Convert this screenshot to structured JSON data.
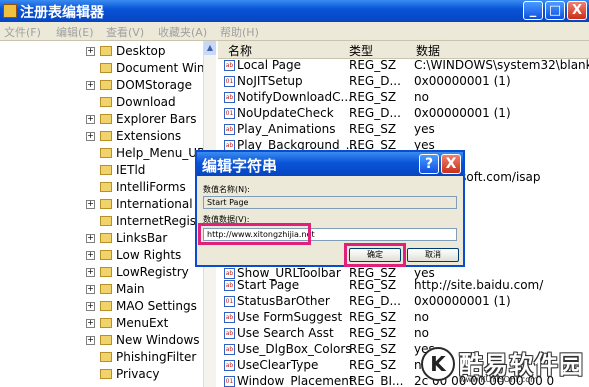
{
  "window": {
    "title": "注册表编辑器",
    "minimize": "_",
    "maximize": "□",
    "close": "X"
  },
  "menu": [
    "文件(F)",
    "编辑(E)",
    "查看(V)",
    "收藏夹(A)",
    "帮助(H)"
  ],
  "tree": {
    "items": [
      {
        "label": "Desktop",
        "expander": "+"
      },
      {
        "label": "Document Windo",
        "expander": ""
      },
      {
        "label": "DOMStorage",
        "expander": "+"
      },
      {
        "label": "Download",
        "expander": ""
      },
      {
        "label": "Explorer Bars",
        "expander": "+"
      },
      {
        "label": "Extensions",
        "expander": "+"
      },
      {
        "label": "Help_Menu_UR",
        "expander": ""
      },
      {
        "label": "IETld",
        "expander": ""
      },
      {
        "label": "IntelliForms",
        "expander": ""
      },
      {
        "label": "International",
        "expander": "+"
      },
      {
        "label": "InternetRegistr",
        "expander": ""
      },
      {
        "label": "LinksBar",
        "expander": "+"
      },
      {
        "label": "Low Rights",
        "expander": "+"
      },
      {
        "label": "LowRegistry",
        "expander": "+"
      },
      {
        "label": "Main",
        "expander": "+"
      },
      {
        "label": "MAO Settings",
        "expander": "+"
      },
      {
        "label": "MenuExt",
        "expander": "+"
      },
      {
        "label": "New Windows",
        "expander": "+"
      },
      {
        "label": "PhishingFilter",
        "expander": ""
      },
      {
        "label": "Privacy",
        "expander": ""
      }
    ]
  },
  "list": {
    "headers": {
      "name": "名称",
      "type": "类型",
      "data": "数据"
    },
    "rows": [
      {
        "name": "Local Page",
        "type": "REG_SZ",
        "data": "C:\\WINDOWS\\system32\\blank.",
        "icon": "ab"
      },
      {
        "name": "NoJITSetup",
        "type": "REG_D...",
        "data": "0x00000001 (1)",
        "icon": "01"
      },
      {
        "name": "NotifyDownloadC...",
        "type": "REG_SZ",
        "data": "no",
        "icon": "ab"
      },
      {
        "name": "NoUpdateCheck",
        "type": "REG_D...",
        "data": "0x00000001 (1)",
        "icon": "01"
      },
      {
        "name": "Play_Animations",
        "type": "REG_SZ",
        "data": "yes",
        "icon": "ab"
      },
      {
        "name": "Play_Background_...",
        "type": "REG_SZ",
        "data": "yes",
        "icon": "ab"
      },
      {
        "name": "",
        "type": "",
        "data": "w.microsoft.com/isap",
        "icon": ""
      },
      {
        "name": "",
        "type": "",
        "data": "",
        "icon": ""
      },
      {
        "name": "",
        "type": "",
        "data": "",
        "icon": ""
      },
      {
        "name": "",
        "type": "",
        "data": "",
        "icon": ""
      },
      {
        "name": "",
        "type": "",
        "data": "",
        "icon": ""
      },
      {
        "name": "",
        "type": "",
        "data": "",
        "icon": ""
      },
      {
        "name": "Show_URLToolbar",
        "type": "REG_SZ",
        "data": "yes",
        "icon": "ab"
      },
      {
        "name": "Start Page",
        "type": "REG_SZ",
        "data": "http://site.baidu.com/",
        "icon": "ab"
      },
      {
        "name": "StatusBarOther",
        "type": "REG_D...",
        "data": "0x00000001 (1)",
        "icon": "01"
      },
      {
        "name": "Use FormSuggest",
        "type": "REG_SZ",
        "data": "no",
        "icon": "ab"
      },
      {
        "name": "Use Search Asst",
        "type": "REG_SZ",
        "data": "no",
        "icon": "ab"
      },
      {
        "name": "Use_DlgBox_Colors",
        "type": "REG_SZ",
        "data": "yes",
        "icon": "ab"
      },
      {
        "name": "UseClearType",
        "type": "REG_SZ",
        "data": "no",
        "icon": "ab"
      },
      {
        "name": "Window_Placement",
        "type": "REG_BI...",
        "data": "2c 00 00 00 00 00 00 0",
        "icon": "01"
      }
    ]
  },
  "dialog": {
    "title": "编辑字符串",
    "help": "?",
    "close": "X",
    "name_label": "数值名称(N):",
    "name_value": "Start Page",
    "data_label": "数值数据(V):",
    "data_value": "http://www.xitongzhijia.net",
    "ok": "确定",
    "cancel": "取消",
    "highlight_color": "#e0207a"
  },
  "watermark": {
    "logo_letter": "K",
    "brand": "酷易软件园",
    "url": "www.KUYISOFT.com"
  }
}
